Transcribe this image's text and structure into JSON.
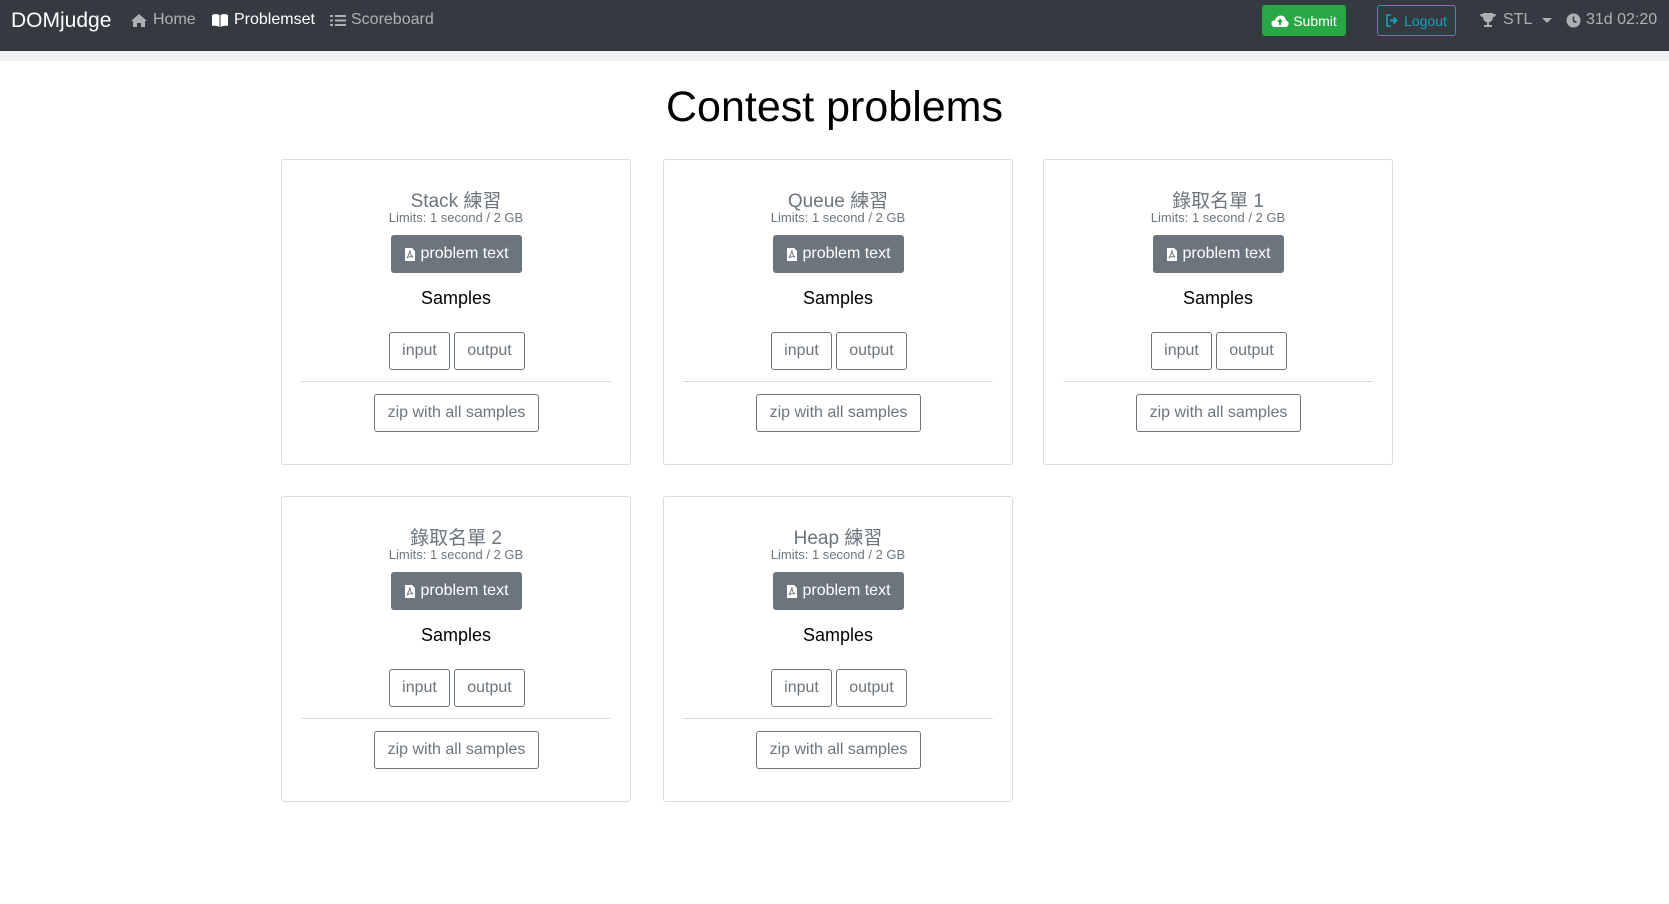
{
  "navbar": {
    "brand": "DOMjudge",
    "links": [
      {
        "label": "Home",
        "icon": "home-icon"
      },
      {
        "label": "Problemset",
        "icon": "book-icon",
        "active": true
      },
      {
        "label": "Scoreboard",
        "icon": "list-icon"
      }
    ],
    "submit_label": "Submit",
    "logout_label": "Logout",
    "contest_label": "STL",
    "time_left": "31d 02:20"
  },
  "page": {
    "title": "Contest problems"
  },
  "problems": [
    {
      "name": "Stack 練習",
      "limits": "Limits: 1 second / 2 GB",
      "problem_text_label": "problem text",
      "samples_label": "Samples",
      "input_label": "input",
      "output_label": "output",
      "zip_label": "zip with all samples"
    },
    {
      "name": "Queue 練習",
      "limits": "Limits: 1 second / 2 GB",
      "problem_text_label": "problem text",
      "samples_label": "Samples",
      "input_label": "input",
      "output_label": "output",
      "zip_label": "zip with all samples"
    },
    {
      "name": "錄取名單 1",
      "limits": "Limits: 1 second / 2 GB",
      "problem_text_label": "problem text",
      "samples_label": "Samples",
      "input_label": "input",
      "output_label": "output",
      "zip_label": "zip with all samples"
    },
    {
      "name": "錄取名單 2",
      "limits": "Limits: 1 second / 2 GB",
      "problem_text_label": "problem text",
      "samples_label": "Samples",
      "input_label": "input",
      "output_label": "output",
      "zip_label": "zip with all samples"
    },
    {
      "name": "Heap 練習",
      "limits": "Limits: 1 second / 2 GB",
      "problem_text_label": "problem text",
      "samples_label": "Samples",
      "input_label": "input",
      "output_label": "output",
      "zip_label": "zip with all samples"
    }
  ],
  "colors": {
    "navbar_bg": "#343a40",
    "submit_green": "#28a745",
    "logout_teal": "#17a2b8",
    "secondary_gray": "#6c757d"
  }
}
